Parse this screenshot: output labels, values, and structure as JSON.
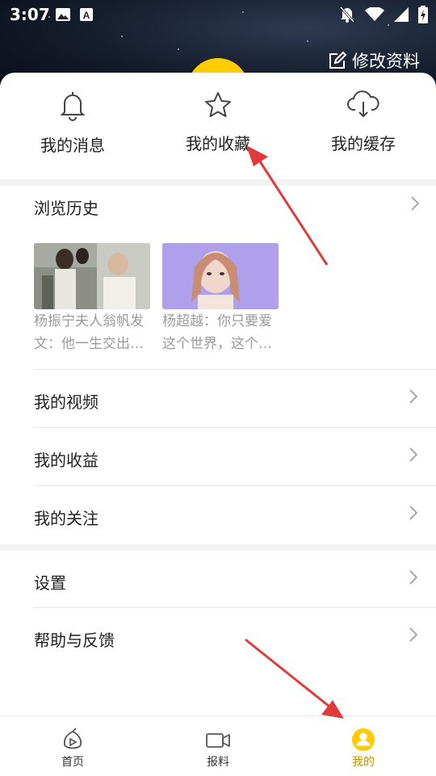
{
  "status_bar": {
    "time": "3:07",
    "left_icons": [
      "image-icon",
      "font-a-icon"
    ],
    "right_icons": [
      "notifications-off-icon",
      "wifi-icon",
      "signal-icon",
      "battery-charging-icon"
    ]
  },
  "header": {
    "edit_profile_label": "修改资料",
    "avatar_color": "#fecc00"
  },
  "quick_actions": [
    {
      "label": "我的消息",
      "icon": "bell-icon"
    },
    {
      "label": "我的收藏",
      "icon": "star-icon"
    },
    {
      "label": "我的缓存",
      "icon": "cloud-download-icon"
    }
  ],
  "history": {
    "title": "浏览历史",
    "items": [
      {
        "caption_line1": "杨振宁夫人翁帆发",
        "caption_line2": "文：他一生交出…"
      },
      {
        "caption_line1": "杨超越：你只要爱",
        "caption_line2": "这个世界，这个…"
      }
    ]
  },
  "menu": {
    "group1": [
      "我的视频",
      "我的收益",
      "我的关注"
    ],
    "group2": [
      "设置",
      "帮助与反馈"
    ]
  },
  "bottom_nav": {
    "items": [
      {
        "label": "首页",
        "icon": "home-play-icon",
        "active": false
      },
      {
        "label": "报料",
        "icon": "video-camera-icon",
        "active": false
      },
      {
        "label": "我的",
        "icon": "user-icon",
        "active": true
      }
    ],
    "active_color": "#fecc00"
  },
  "annotation_color": "#e03a3a"
}
